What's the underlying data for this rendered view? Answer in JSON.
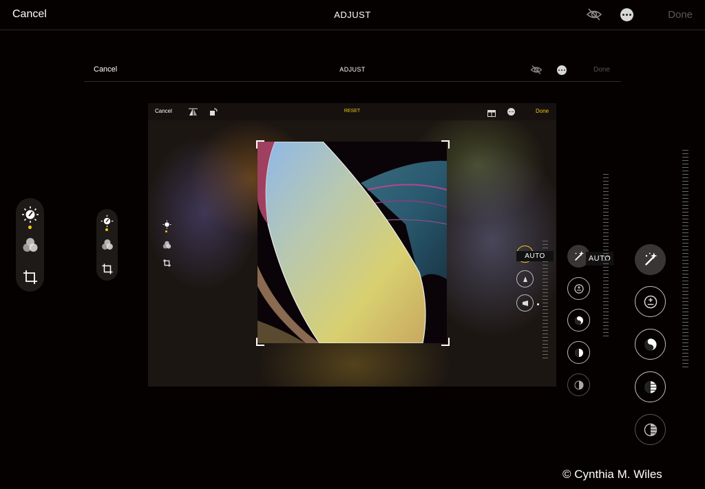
{
  "outer": {
    "cancel_label": "Cancel",
    "title": "ADJUST",
    "done_label": "Done",
    "auto_label": "AUTO"
  },
  "middle": {
    "cancel_label": "Cancel",
    "title": "ADJUST",
    "done_label": "Done",
    "auto_label": "AUTO"
  },
  "inner": {
    "cancel_label": "Cancel",
    "reset_label": "RESET",
    "done_label": "Done",
    "dial_value": "37"
  },
  "tools": [
    "adjust-icon",
    "filters-icon",
    "crop-icon"
  ],
  "adjustments": [
    "auto-wand-icon",
    "exposure-icon",
    "brilliance-icon",
    "highlights-icon",
    "shadows-icon"
  ],
  "colors": {
    "accent": "#f5c518",
    "background": "#050100",
    "done_disabled": "#5a5a5a"
  },
  "watermark": "© Cynthia M. Wiles"
}
